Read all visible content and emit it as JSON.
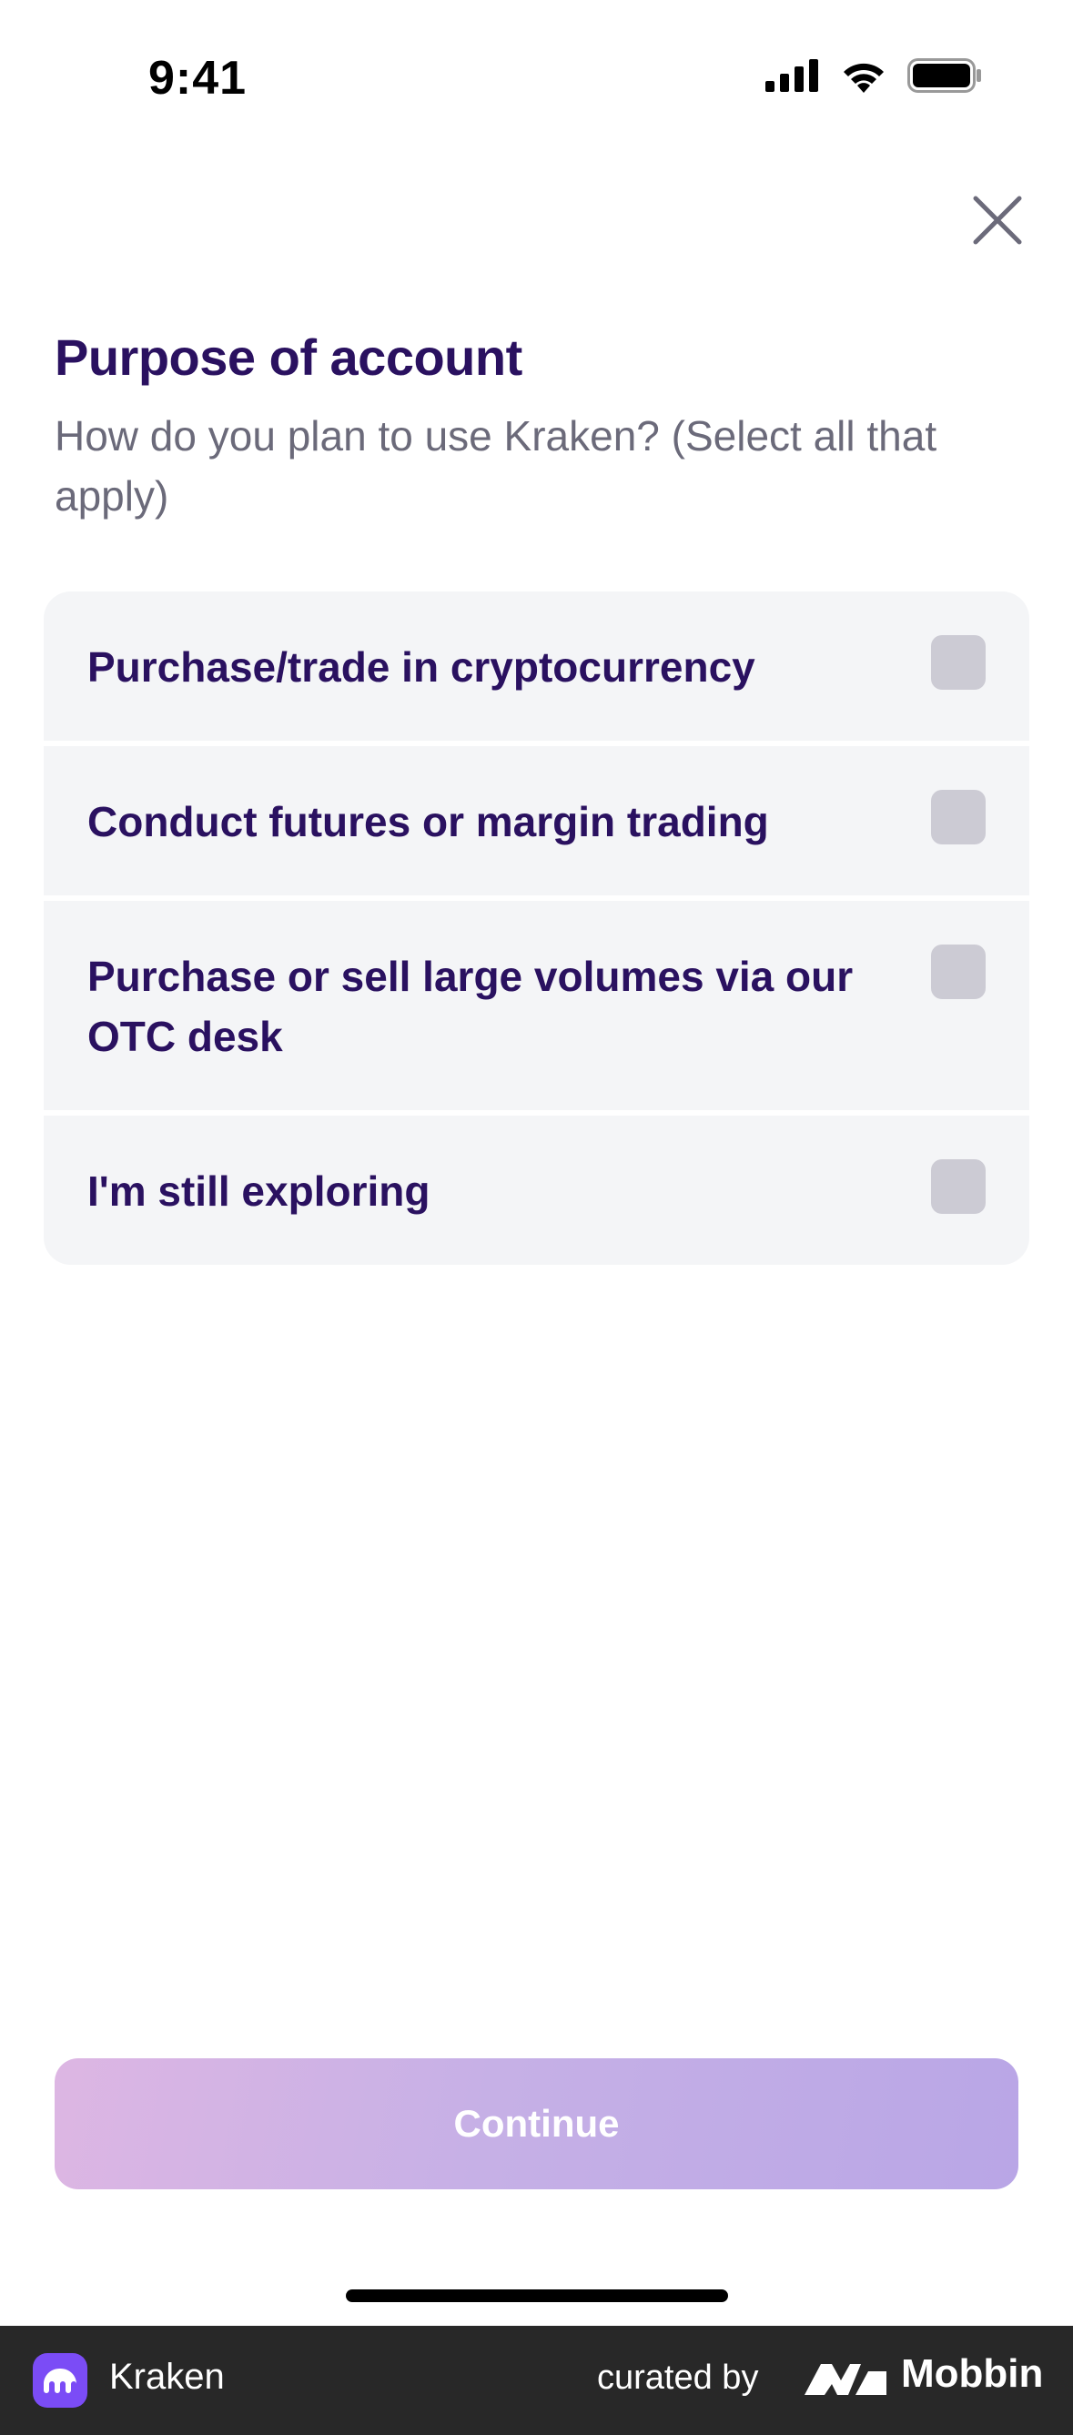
{
  "status_bar": {
    "time": "9:41"
  },
  "header": {
    "title": "Purpose of account",
    "subtitle": "How do you plan to use Kraken? (Select all that apply)"
  },
  "options": [
    {
      "label": "Purchase/trade in cryptocurrency",
      "checked": false
    },
    {
      "label": "Conduct futures or margin trading",
      "checked": false
    },
    {
      "label": "Purchase or sell large volumes via our OTC desk",
      "checked": false
    },
    {
      "label": "I'm still exploring",
      "checked": false
    }
  ],
  "continue_button": {
    "label": "Continue"
  },
  "footer": {
    "app_name": "Kraken",
    "curated_by": "curated by",
    "brand": "Mobbin"
  },
  "colors": {
    "accent": "#2a1160",
    "option_bg": "#f4f5f7",
    "checkbox": "#cccbd4",
    "button_gradient_start": "#ddb6e3",
    "button_gradient_end": "#b9a6e6",
    "footer_bg": "#282828",
    "app_icon": "#7b4cf6"
  }
}
